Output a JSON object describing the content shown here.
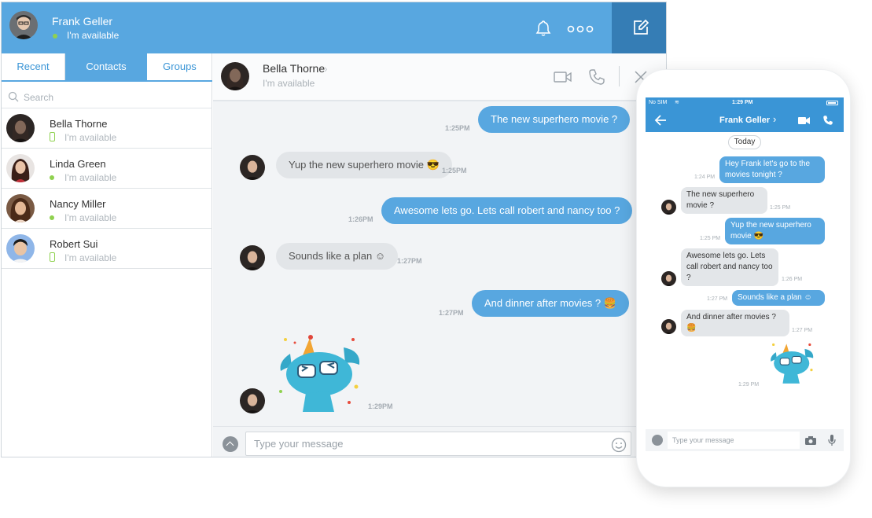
{
  "me": {
    "name": "Frank Geller",
    "status": "I'm available"
  },
  "tabs": [
    "Recent",
    "Contacts",
    "Groups"
  ],
  "search": {
    "placeholder": "Search"
  },
  "contacts": [
    {
      "name": "Bella Thorne",
      "status": "I'm available"
    },
    {
      "name": "Linda Green",
      "status": "I'm available"
    },
    {
      "name": "Nancy Miller",
      "status": "I'm available"
    },
    {
      "name": "Robert Sui",
      "status": "I'm available"
    }
  ],
  "chat": {
    "name": "Bella Thorne",
    "status": "I'm available",
    "messages": [
      {
        "text": "The new superhero movie ?",
        "time": "1:25PM"
      },
      {
        "text": "Yup the new superhero movie 😎",
        "time": "1:25PM"
      },
      {
        "text": "Awesome lets go. Lets call robert and nancy too ?",
        "time": "1:26PM"
      },
      {
        "text": "Sounds like a plan ☺",
        "time": "1:27PM"
      },
      {
        "text": "And dinner after movies ? 🍔",
        "time": "1:27PM"
      },
      {
        "text": "",
        "time": "1:29PM"
      }
    ],
    "input_placeholder": "Type your message"
  },
  "phone": {
    "status_left": "No SIM",
    "clock": "1:29 PM",
    "title": "Frank Geller",
    "today": "Today",
    "messages": [
      {
        "text": "Hey Frank let's go to the movies tonight ?",
        "time": "1:24 PM"
      },
      {
        "text": "The new superhero movie ?",
        "time": "1:25 PM"
      },
      {
        "text": "Yup the new superhero movie 😎",
        "time": "1:25 PM"
      },
      {
        "text": "Awesome lets go. Lets call robert and nancy too ?",
        "time": "1:26 PM"
      },
      {
        "text": "Sounds like a plan ☺",
        "time": "1:27 PM"
      },
      {
        "text": "And dinner after movies ? 🍔",
        "time": "1:27 PM"
      },
      {
        "text": "",
        "time": "1:29 PM"
      }
    ],
    "input_placeholder": "Type your message"
  },
  "colors": {
    "accent": "#58a7e0",
    "accent_dark": "#357db5",
    "online": "#8fd14f"
  }
}
